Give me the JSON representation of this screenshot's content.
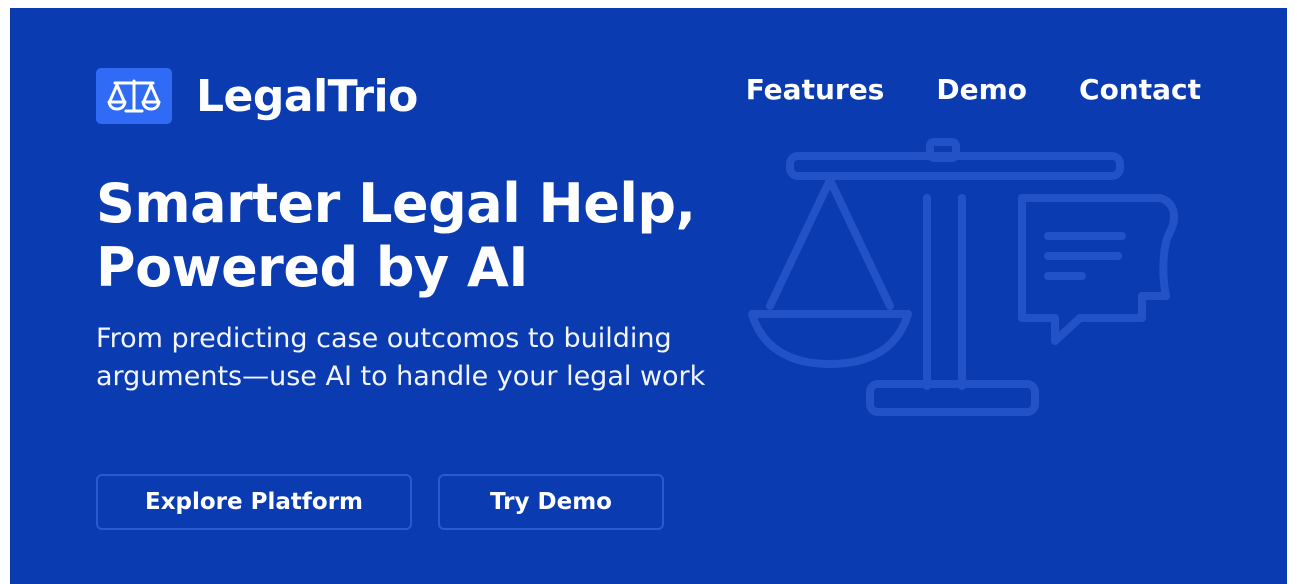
{
  "brand": {
    "name": "LegalTrio",
    "icon": "scales-icon",
    "icon_bg": "#2f6bf5"
  },
  "nav": {
    "items": [
      {
        "label": "Features"
      },
      {
        "label": "Demo"
      },
      {
        "label": "Contact"
      }
    ]
  },
  "hero": {
    "headline_line1": "Smarter Legal Help,",
    "headline_line2": "Powered by AI",
    "subtitle": "From predicting case outcomos to building arguments—use AI to handle your legal work",
    "watermark_icon": "scales-and-document-icon"
  },
  "buttons": {
    "explore_label": "Explore Platform",
    "demo_label": "Try Demo"
  },
  "colors": {
    "background": "#0a3bb0",
    "text": "#ffffff",
    "button_border": "#2a59d0"
  }
}
